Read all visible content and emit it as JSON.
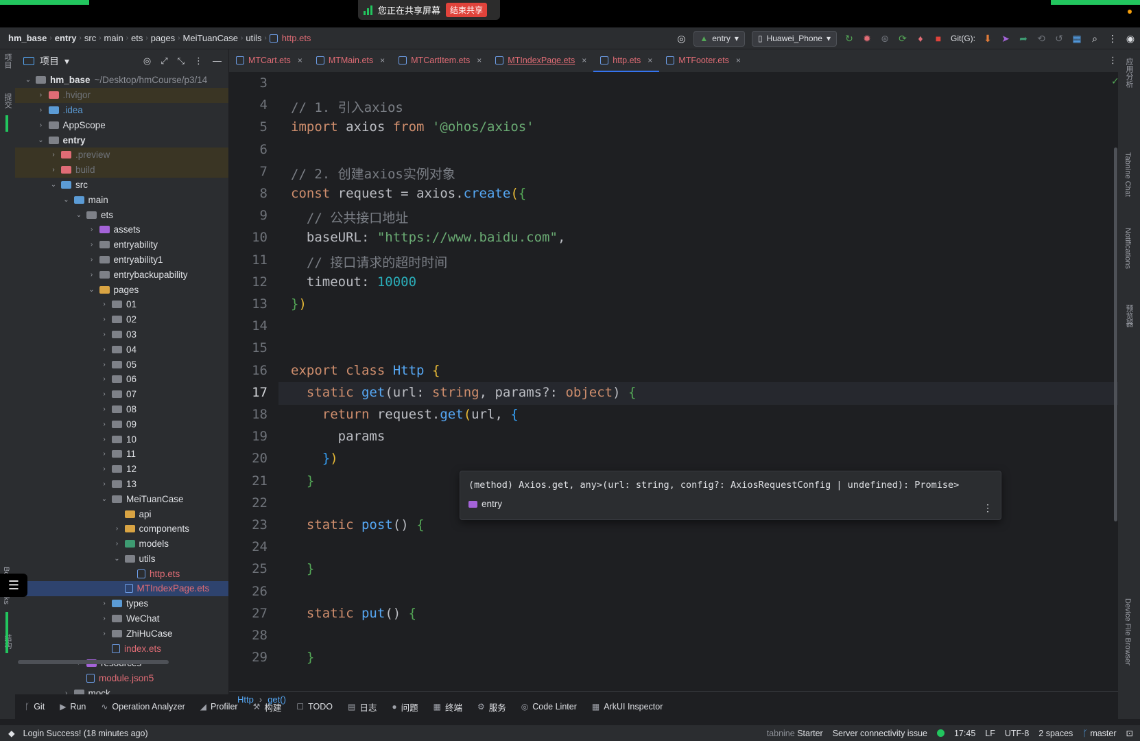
{
  "share_bar": {
    "text": "您正在共享屏幕",
    "stop": "结束共享"
  },
  "navbar": {
    "breadcrumbs": [
      "hm_base",
      "entry",
      "src",
      "main",
      "ets",
      "pages",
      "MeiTuanCase",
      "utils"
    ],
    "current_file": "http.ets",
    "run_config": "entry",
    "device": "Huawei_Phone",
    "git_label": "Git(G):"
  },
  "left_strip": {
    "project": "项目",
    "commit": "提交",
    "bookmarks": "Bookmarks",
    "structure": "结构"
  },
  "project_panel": {
    "title": "项目",
    "tree": [
      {
        "label": "hm_base",
        "extra": "~/Desktop/hmCourse/p3/14",
        "indent": 0,
        "arrow": "down",
        "folder": "gray",
        "style": "bold"
      },
      {
        "label": ".hvigor",
        "indent": 1,
        "arrow": "right",
        "folder": "red",
        "style": "excl"
      },
      {
        "label": ".idea",
        "indent": 1,
        "arrow": "right",
        "folder": "blue",
        "style": "blue"
      },
      {
        "label": "AppScope",
        "indent": 1,
        "arrow": "right",
        "folder": "gray",
        "style": ""
      },
      {
        "label": "entry",
        "indent": 1,
        "arrow": "down",
        "folder": "gray",
        "style": "bold"
      },
      {
        "label": ".preview",
        "indent": 2,
        "arrow": "right",
        "folder": "red",
        "style": "excl"
      },
      {
        "label": "build",
        "indent": 2,
        "arrow": "right",
        "folder": "red",
        "style": "excl"
      },
      {
        "label": "src",
        "indent": 2,
        "arrow": "down",
        "folder": "blue",
        "style": ""
      },
      {
        "label": "main",
        "indent": 3,
        "arrow": "down",
        "folder": "blue",
        "style": ""
      },
      {
        "label": "ets",
        "indent": 4,
        "arrow": "down",
        "folder": "gray",
        "style": ""
      },
      {
        "label": "assets",
        "indent": 5,
        "arrow": "right",
        "folder": "purple",
        "style": ""
      },
      {
        "label": "entryability",
        "indent": 5,
        "arrow": "right",
        "folder": "gray",
        "style": ""
      },
      {
        "label": "entryability1",
        "indent": 5,
        "arrow": "right",
        "folder": "gray",
        "style": ""
      },
      {
        "label": "entrybackupability",
        "indent": 5,
        "arrow": "right",
        "folder": "gray",
        "style": ""
      },
      {
        "label": "pages",
        "indent": 5,
        "arrow": "down",
        "folder": "yellow",
        "style": ""
      },
      {
        "label": "01",
        "indent": 6,
        "arrow": "right",
        "folder": "gray",
        "style": ""
      },
      {
        "label": "02",
        "indent": 6,
        "arrow": "right",
        "folder": "gray",
        "style": ""
      },
      {
        "label": "03",
        "indent": 6,
        "arrow": "right",
        "folder": "gray",
        "style": ""
      },
      {
        "label": "04",
        "indent": 6,
        "arrow": "right",
        "folder": "gray",
        "style": ""
      },
      {
        "label": "05",
        "indent": 6,
        "arrow": "right",
        "folder": "gray",
        "style": ""
      },
      {
        "label": "06",
        "indent": 6,
        "arrow": "right",
        "folder": "gray",
        "style": ""
      },
      {
        "label": "07",
        "indent": 6,
        "arrow": "right",
        "folder": "gray",
        "style": ""
      },
      {
        "label": "08",
        "indent": 6,
        "arrow": "right",
        "folder": "gray",
        "style": ""
      },
      {
        "label": "09",
        "indent": 6,
        "arrow": "right",
        "folder": "gray",
        "style": ""
      },
      {
        "label": "10",
        "indent": 6,
        "arrow": "right",
        "folder": "gray",
        "style": ""
      },
      {
        "label": "11",
        "indent": 6,
        "arrow": "right",
        "folder": "gray",
        "style": ""
      },
      {
        "label": "12",
        "indent": 6,
        "arrow": "right",
        "folder": "gray",
        "style": ""
      },
      {
        "label": "13",
        "indent": 6,
        "arrow": "right",
        "folder": "gray",
        "style": ""
      },
      {
        "label": "MeiTuanCase",
        "indent": 6,
        "arrow": "down",
        "folder": "gray",
        "style": ""
      },
      {
        "label": "api",
        "indent": 7,
        "arrow": "",
        "folder": "yellow",
        "style": ""
      },
      {
        "label": "components",
        "indent": 7,
        "arrow": "right",
        "folder": "yellow",
        "style": ""
      },
      {
        "label": "models",
        "indent": 7,
        "arrow": "right",
        "folder": "green",
        "style": ""
      },
      {
        "label": "utils",
        "indent": 7,
        "arrow": "down",
        "folder": "gray",
        "style": ""
      },
      {
        "label": "http.ets",
        "indent": 8,
        "arrow": "",
        "folder": "file",
        "style": "red"
      },
      {
        "label": "MTIndexPage.ets",
        "indent": 7,
        "arrow": "",
        "folder": "file",
        "style": "red sel"
      },
      {
        "label": "types",
        "indent": 6,
        "arrow": "right",
        "folder": "blue",
        "style": ""
      },
      {
        "label": "WeChat",
        "indent": 6,
        "arrow": "right",
        "folder": "gray",
        "style": ""
      },
      {
        "label": "ZhiHuCase",
        "indent": 6,
        "arrow": "right",
        "folder": "gray",
        "style": ""
      },
      {
        "label": "index.ets",
        "indent": 6,
        "arrow": "",
        "folder": "file",
        "style": "red"
      },
      {
        "label": "resources",
        "indent": 4,
        "arrow": "right",
        "folder": "purple",
        "style": ""
      },
      {
        "label": "module.json5",
        "indent": 4,
        "arrow": "",
        "folder": "file",
        "style": "red"
      },
      {
        "label": "mock",
        "indent": 3,
        "arrow": "right",
        "folder": "gray",
        "style": ""
      }
    ]
  },
  "tabs": [
    {
      "label": "MTCart.ets",
      "active": false,
      "underline": false
    },
    {
      "label": "MTMain.ets",
      "active": false,
      "underline": false
    },
    {
      "label": "MTCartItem.ets",
      "active": false,
      "underline": false
    },
    {
      "label": "MTIndexPage.ets",
      "active": false,
      "underline": true
    },
    {
      "label": "http.ets",
      "active": true,
      "underline": false
    },
    {
      "label": "MTFooter.ets",
      "active": false,
      "underline": false
    }
  ],
  "editor": {
    "current_line": 17,
    "lines": [
      {
        "n": 3,
        "html": ""
      },
      {
        "n": 4,
        "html": "<span class='cm'>// 1. 引入axios</span>"
      },
      {
        "n": 5,
        "html": "<span class='kw'>import</span> axios <span class='kw'>from</span> <span class='str'>'@ohos/axios'</span>"
      },
      {
        "n": 6,
        "html": ""
      },
      {
        "n": 7,
        "html": "<span class='cm'>// 2. 创建axios实例对象</span>"
      },
      {
        "n": 8,
        "html": "<span class='kw'>const</span> request = axios.<span class='fn'>create</span><span class='br1'>(</span><span class='br2'>{</span>"
      },
      {
        "n": 9,
        "html": "  <span class='cm'>// 公共接口地址</span>"
      },
      {
        "n": 10,
        "html": "  baseURL: <span class='str'>\"https://www.baidu.com\"</span>,"
      },
      {
        "n": 11,
        "html": "  <span class='cm'>// 接口请求的超时时间</span>"
      },
      {
        "n": 12,
        "html": "  timeout: <span class='num'>10000</span>"
      },
      {
        "n": 13,
        "html": "<span class='br2'>}</span><span class='br1'>)</span>"
      },
      {
        "n": 14,
        "html": ""
      },
      {
        "n": 15,
        "html": ""
      },
      {
        "n": 16,
        "html": "<span class='kw'>export class</span> <span class='cls'>Http</span> <span class='br1'>{</span>"
      },
      {
        "n": 17,
        "html": "  <span class='kw'>static</span> <span class='fn'>get</span>(url: <span class='ty'>string</span>, params?: <span class='ty'>object</span>) <span class='br2'>{</span>"
      },
      {
        "n": 18,
        "html": "    <span class='kw'>return</span> request.<span class='fn'>get</span><span class='br1'>(</span>url, <span class='br3'>{</span>"
      },
      {
        "n": 19,
        "html": "      params"
      },
      {
        "n": 20,
        "html": "    <span class='br3'>}</span><span class='br1'>)</span>"
      },
      {
        "n": 21,
        "html": "  <span class='br2'>}</span>"
      },
      {
        "n": 22,
        "html": ""
      },
      {
        "n": 23,
        "html": "  <span class='kw'>static</span> <span class='fn'>post</span>() <span class='br2'>{</span>"
      },
      {
        "n": 24,
        "html": ""
      },
      {
        "n": 25,
        "html": "  <span class='br2'>}</span>"
      },
      {
        "n": 26,
        "html": ""
      },
      {
        "n": 27,
        "html": "  <span class='kw'>static</span> <span class='fn'>put</span>() <span class='br2'>{</span>"
      },
      {
        "n": 28,
        "html": ""
      },
      {
        "n": 29,
        "html": "  <span class='br2'>}</span>"
      }
    ],
    "tooltip": {
      "signature": "(method) Axios.get, any>(url: string, config?: AxiosRequestConfig | undefined): Promise>",
      "module": "entry"
    }
  },
  "editor_breadcrumb": {
    "class": "Http",
    "method": "get()"
  },
  "right_strip": {
    "tabnine": "Tabnine Chat",
    "notifications": "Notifications",
    "preview": "预览器",
    "device_files": "Device File Browser",
    "app_analysis": "应用分析"
  },
  "bottom_tools": [
    "Git",
    "Run",
    "Operation Analyzer",
    "Profiler",
    "构建",
    "TODO",
    "日志",
    "问题",
    "终端",
    "服务",
    "Code Linter",
    "ArkUI Inspector"
  ],
  "status_bar": {
    "message": "Login Success! (18 minutes ago)",
    "tabnine": "tabnine",
    "tabnine_plan": "Starter",
    "server": "Server connectivity issue",
    "time": "17:45",
    "line_sep": "LF",
    "encoding": "UTF-8",
    "indent": "2 spaces",
    "branch": "master"
  },
  "colors": {
    "accent": "#3574f0",
    "share_green": "#22c55e",
    "stop_red": "#e0433b"
  }
}
